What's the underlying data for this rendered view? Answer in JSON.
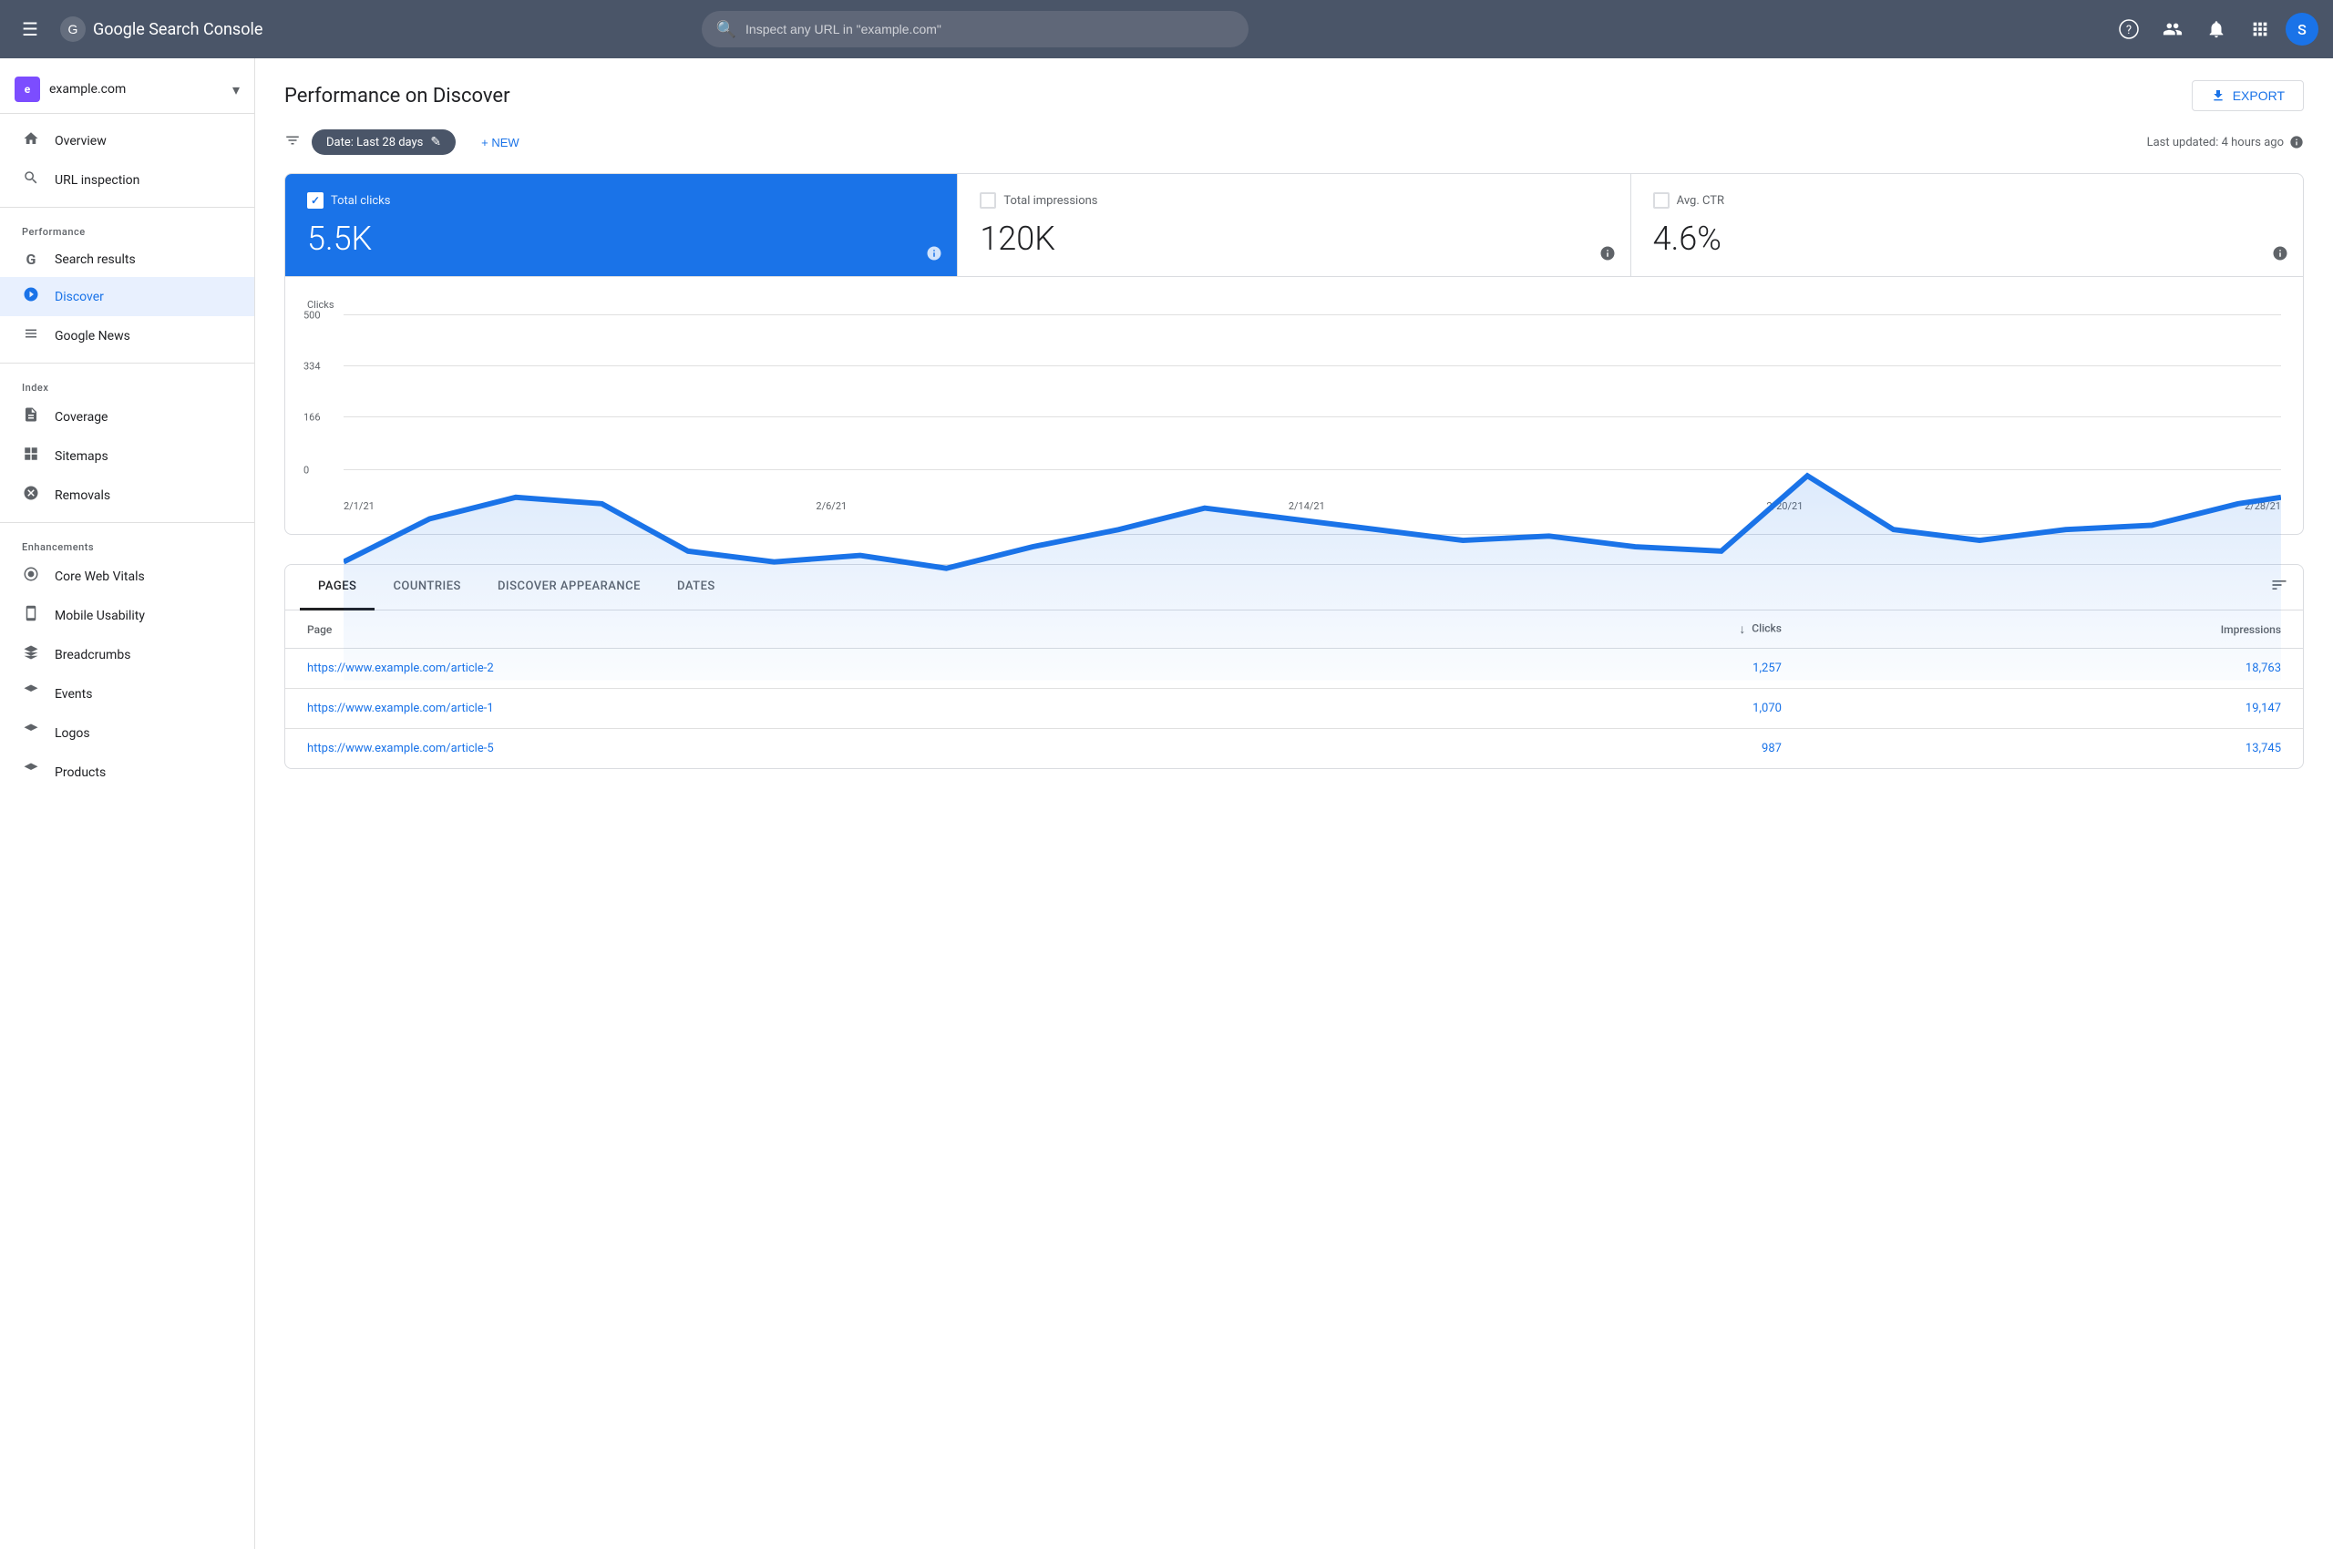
{
  "topbar": {
    "menu_icon": "☰",
    "logo_text": "Google Search Console",
    "search_placeholder": "Inspect any URL in \"example.com\"",
    "help_icon": "?",
    "people_icon": "👤",
    "bell_icon": "🔔",
    "grid_icon": "⊞",
    "avatar_letter": "S"
  },
  "sidebar": {
    "property_name": "example.com",
    "property_icon": "e",
    "nav_items": [
      {
        "id": "overview",
        "label": "Overview",
        "icon": "🏠"
      },
      {
        "id": "url-inspection",
        "label": "URL inspection",
        "icon": "🔍"
      }
    ],
    "performance_section": "Performance",
    "performance_items": [
      {
        "id": "search-results",
        "label": "Search results",
        "icon": "G"
      },
      {
        "id": "discover",
        "label": "Discover",
        "icon": "✳",
        "active": true
      },
      {
        "id": "google-news",
        "label": "Google News",
        "icon": "▦"
      }
    ],
    "index_section": "Index",
    "index_items": [
      {
        "id": "coverage",
        "label": "Coverage",
        "icon": "📄"
      },
      {
        "id": "sitemaps",
        "label": "Sitemaps",
        "icon": "▦"
      },
      {
        "id": "removals",
        "label": "Removals",
        "icon": "🚫"
      }
    ],
    "enhancements_section": "Enhancements",
    "enhancements_items": [
      {
        "id": "core-web-vitals",
        "label": "Core Web Vitals",
        "icon": "◑"
      },
      {
        "id": "mobile-usability",
        "label": "Mobile Usability",
        "icon": "📱"
      },
      {
        "id": "breadcrumbs",
        "label": "Breadcrumbs",
        "icon": "◇"
      },
      {
        "id": "events",
        "label": "Events",
        "icon": "◇"
      },
      {
        "id": "logos",
        "label": "Logos",
        "icon": "◇"
      },
      {
        "id": "products",
        "label": "Products",
        "icon": "◇"
      }
    ]
  },
  "page": {
    "title": "Performance on Discover",
    "export_label": "EXPORT"
  },
  "filter_bar": {
    "date_label": "Date: Last 28 days",
    "new_label": "+ NEW",
    "last_updated": "Last updated: 4 hours ago"
  },
  "metrics": [
    {
      "id": "total-clicks",
      "label": "Total clicks",
      "value": "5.5K",
      "active": true
    },
    {
      "id": "total-impressions",
      "label": "Total impressions",
      "value": "120K",
      "active": false
    },
    {
      "id": "avg-ctr",
      "label": "Avg. CTR",
      "value": "4.6%",
      "active": false
    }
  ],
  "chart": {
    "y_label": "Clicks",
    "y_values": [
      "500",
      "334",
      "166",
      "0"
    ],
    "x_labels": [
      "2/1/21",
      "2/6/21",
      "2/14/21",
      "2/20/21",
      "2/28/21"
    ]
  },
  "table": {
    "tabs": [
      {
        "id": "pages",
        "label": "PAGES",
        "active": true
      },
      {
        "id": "countries",
        "label": "COUNTRIES",
        "active": false
      },
      {
        "id": "discover-appearance",
        "label": "DISCOVER APPEARANCE",
        "active": false
      },
      {
        "id": "dates",
        "label": "DATES",
        "active": false
      }
    ],
    "columns": [
      {
        "id": "page",
        "label": "Page",
        "align": "left"
      },
      {
        "id": "clicks",
        "label": "Clicks",
        "align": "right",
        "sorted": true
      },
      {
        "id": "impressions",
        "label": "Impressions",
        "align": "right"
      }
    ],
    "rows": [
      {
        "page": "https://www.example.com/article-2",
        "clicks": "1,257",
        "impressions": "18,763"
      },
      {
        "page": "https://www.example.com/article-1",
        "clicks": "1,070",
        "impressions": "19,147"
      },
      {
        "page": "https://www.example.com/article-5",
        "clicks": "987",
        "impressions": "13,745"
      }
    ]
  }
}
